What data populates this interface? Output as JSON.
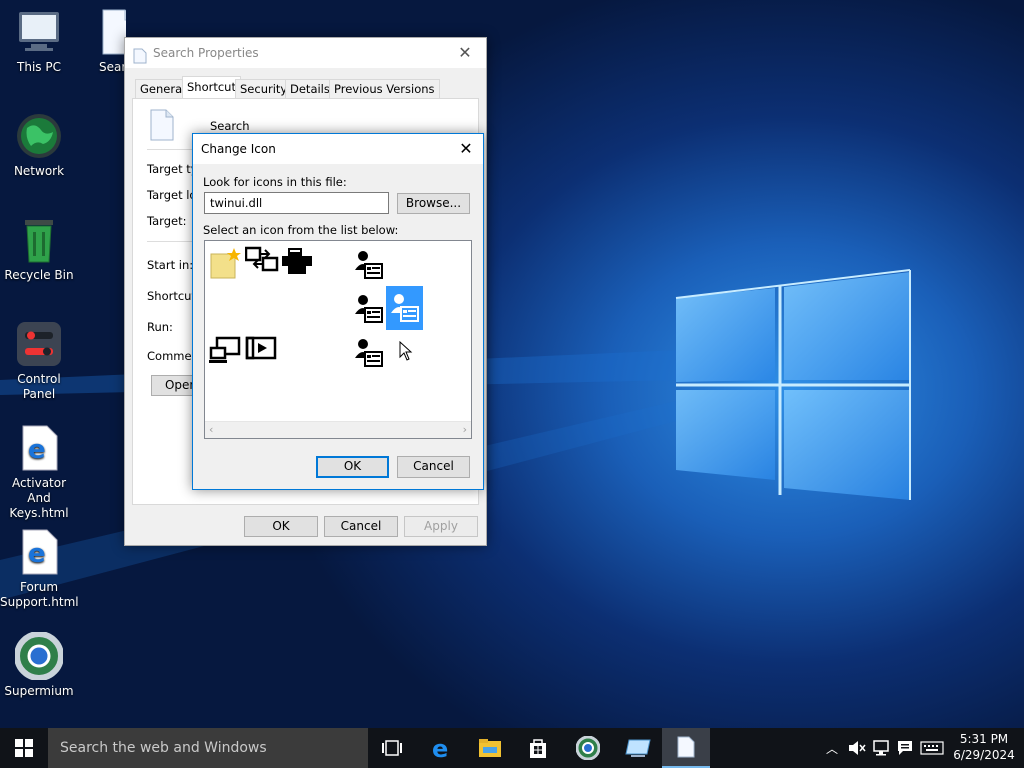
{
  "desktop": {
    "icons": [
      {
        "label": "This PC",
        "icon": "computer-icon"
      },
      {
        "label": "Searc",
        "icon": "file-icon"
      },
      {
        "label": "Network",
        "icon": "globe-icon"
      },
      {
        "label": "Recycle Bin",
        "icon": "recycle-bin-icon"
      },
      {
        "label": "Control Panel",
        "icon": "control-panel-icon"
      },
      {
        "label": "Activator And Keys.html",
        "icon": "edge-file-icon"
      },
      {
        "label": "Forum Support.html",
        "icon": "edge-file-icon"
      },
      {
        "label": "Supermium",
        "icon": "browser-icon"
      }
    ]
  },
  "properties": {
    "title": "Search Properties",
    "tabs": [
      "General",
      "Shortcut",
      "Security",
      "Details",
      "Previous Versions"
    ],
    "selected_tab": "Shortcut",
    "file_name": "Search",
    "fields": [
      "Target typ",
      "Target loc",
      "Target:",
      "Start in:",
      "Shortcut k",
      "Run:",
      "Comment:"
    ],
    "open_button": "Open",
    "ok": "OK",
    "cancel": "Cancel",
    "apply": "Apply"
  },
  "change_icon": {
    "title": "Change Icon",
    "look_label": "Look for icons in this file:",
    "file_value": "twinui.dll",
    "browse": "Browse...",
    "select_label": "Select an icon from the list below:",
    "ok": "OK",
    "cancel": "Cancel",
    "accent": "#0078d7",
    "selected_bg": "#3399ff"
  },
  "taskbar": {
    "search_placeholder": "Search the web and Windows",
    "time": "5:31 PM",
    "date": "6/29/2024"
  }
}
